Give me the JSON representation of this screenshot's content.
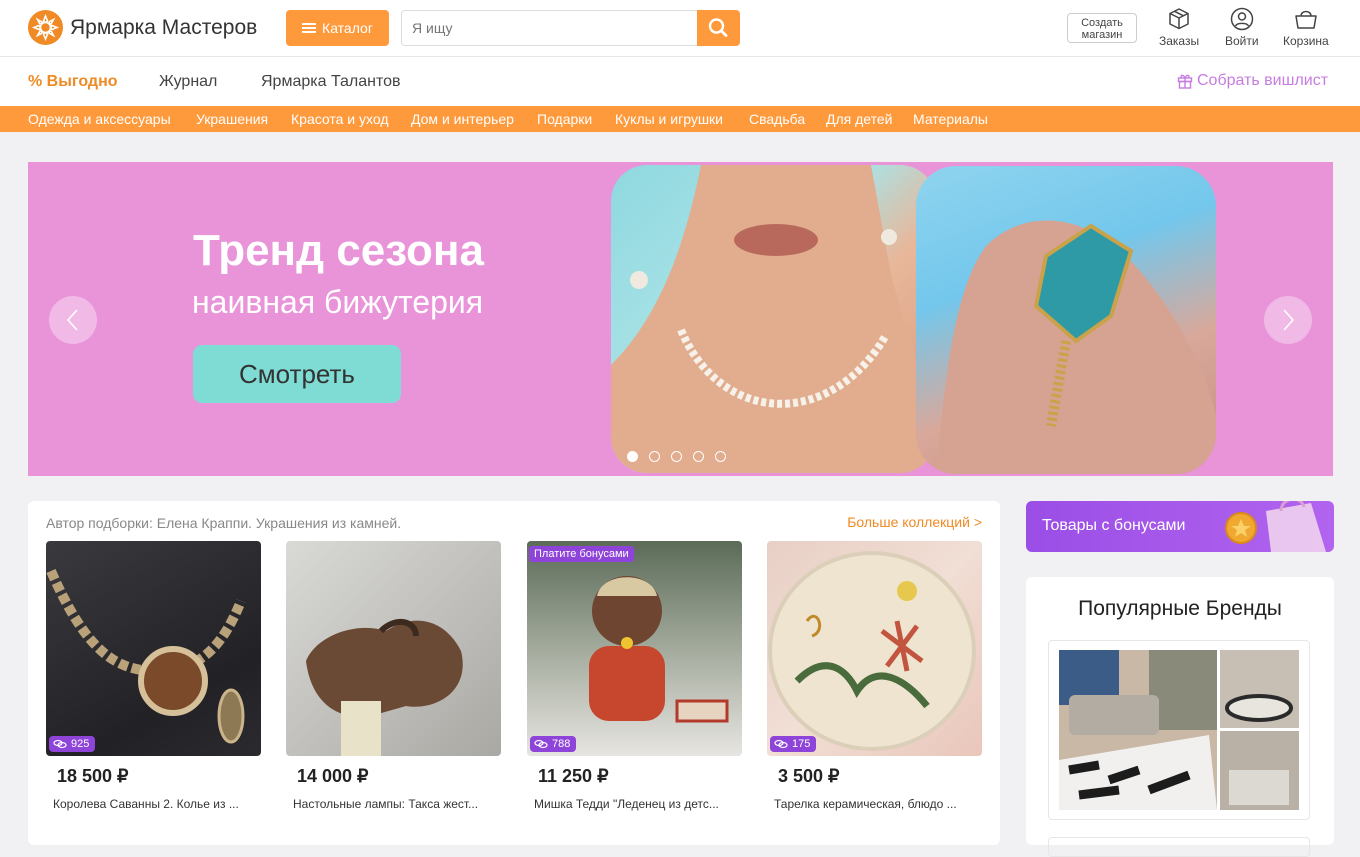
{
  "header": {
    "logo_text": "Ярмарка Мастеров",
    "catalog_label": "Каталог",
    "search_placeholder": "Я ищу",
    "create_shop_line1": "Создать",
    "create_shop_line2": "магазин",
    "orders_label": "Заказы",
    "login_label": "Войти",
    "cart_label": "Корзина"
  },
  "subnav": {
    "promo": "% Выгодно",
    "journal": "Журнал",
    "talents": "Ярмарка Талантов",
    "wishlist": "Собрать вишлист"
  },
  "categories": [
    "Одежда и аксессуары",
    "Украшения",
    "Красота и уход",
    "Дом и интерьер",
    "Подарки",
    "Куклы и игрушки",
    "Свадьба",
    "Для детей",
    "Материалы"
  ],
  "banner": {
    "title": "Тренд сезона",
    "subtitle": "наивная бижутерия",
    "button": "Смотреть",
    "slides_total": 5,
    "active_slide": 1
  },
  "collection": {
    "title": "Автор подборки: Елена Краппи. Украшения из камней.",
    "more_link": "Больше коллекций >",
    "products": [
      {
        "price": "18 500 ₽",
        "name": "Королева Саванны 2. Колье из ...",
        "bonus": "925"
      },
      {
        "price": "14 000 ₽",
        "name": "Настольные лампы: Такса жест...",
        "bonus": ""
      },
      {
        "price": "11 250 ₽",
        "name": "Мишка Тедди \"Леденец из детс...",
        "bonus": "788",
        "tag": "Платите бонусами"
      },
      {
        "price": "3 500 ₽",
        "name": "Тарелка керамическая, блюдо ...",
        "bonus": "175"
      }
    ]
  },
  "sidebar": {
    "bonus_goods": "Товары с бонусами",
    "brands_title": "Популярные Бренды"
  },
  "colors": {
    "accent": "#ff9a3c",
    "banner_bg": "#e994d9",
    "bonus_purple": "#8e44d9",
    "wishlist": "#c77ce0"
  }
}
